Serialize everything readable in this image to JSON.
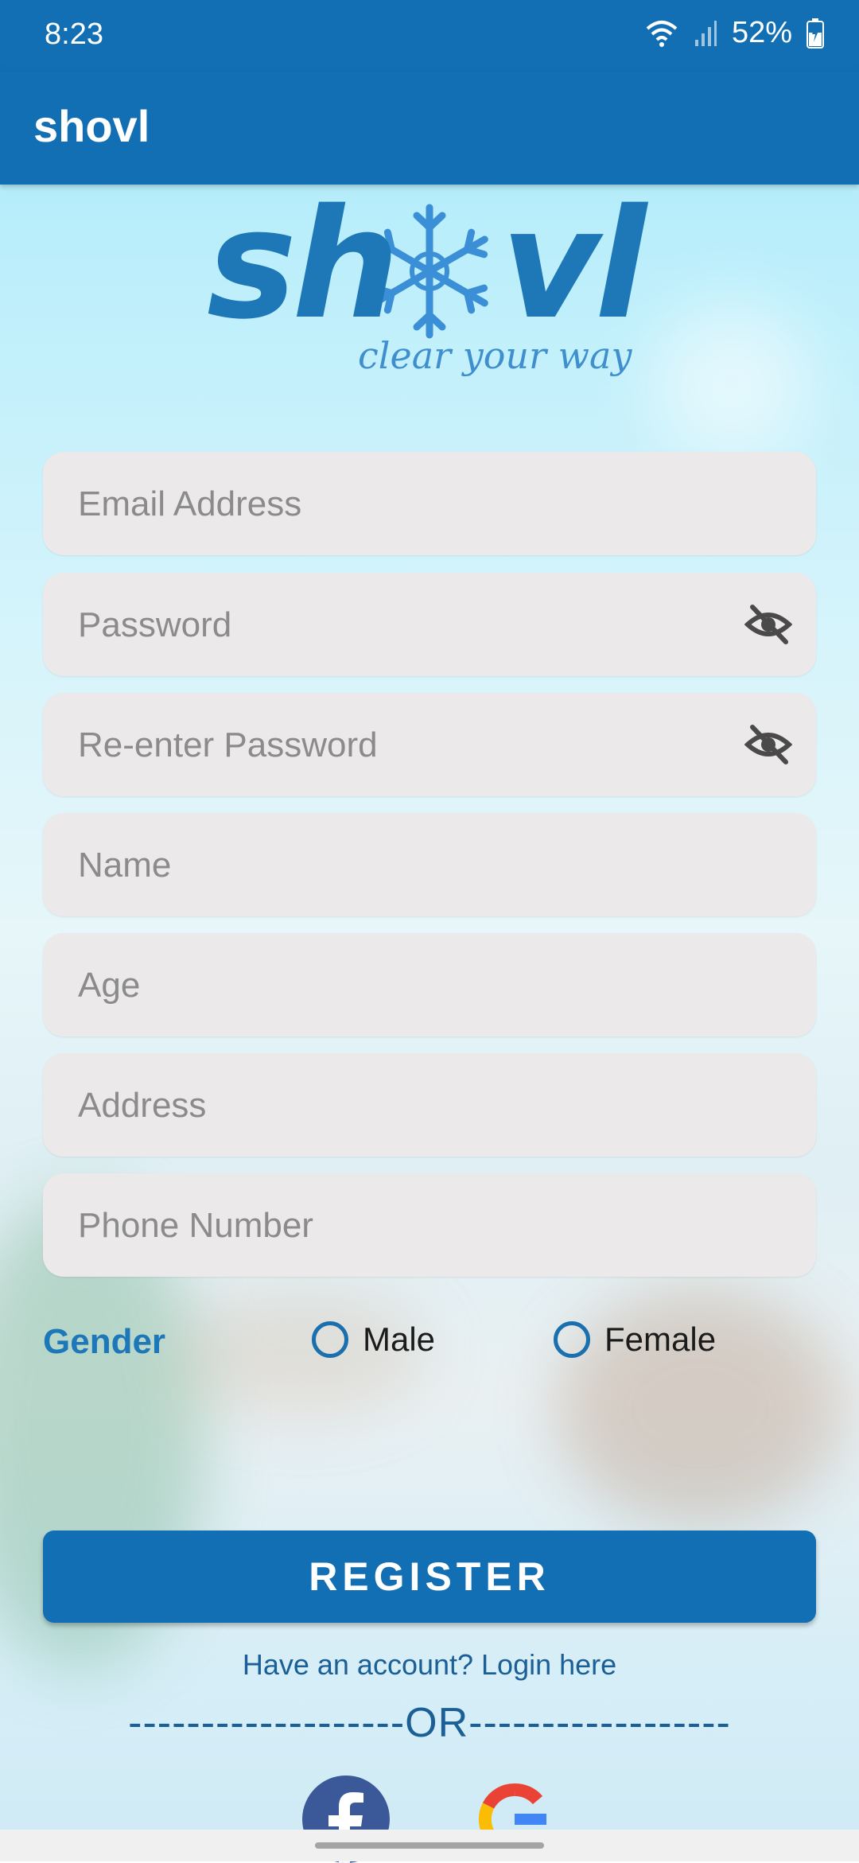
{
  "status_bar": {
    "time": "8:23",
    "battery": "52%"
  },
  "app_bar": {
    "title": "shovl"
  },
  "logo": {
    "wordmark": "shovl",
    "tagline": "clear your way"
  },
  "form": {
    "email": {
      "placeholder": "Email Address",
      "value": ""
    },
    "password": {
      "placeholder": "Password",
      "value": ""
    },
    "confirm_password": {
      "placeholder": "Re-enter Password",
      "value": ""
    },
    "name": {
      "placeholder": "Name",
      "value": ""
    },
    "age": {
      "placeholder": "Age",
      "value": ""
    },
    "address": {
      "placeholder": "Address",
      "value": ""
    },
    "phone": {
      "placeholder": "Phone Number",
      "value": ""
    }
  },
  "gender": {
    "label": "Gender",
    "options": [
      "Male",
      "Female"
    ],
    "selected": null
  },
  "register_button": "REGISTER",
  "login_link": "Have an account? Login here",
  "divider": "-------------------OR------------------",
  "social_icons": [
    "facebook-icon",
    "google-icon"
  ],
  "colors": {
    "primary": "#126fb3",
    "field_bg": "#ebe9ea",
    "gender_label": "#1c78b8"
  }
}
